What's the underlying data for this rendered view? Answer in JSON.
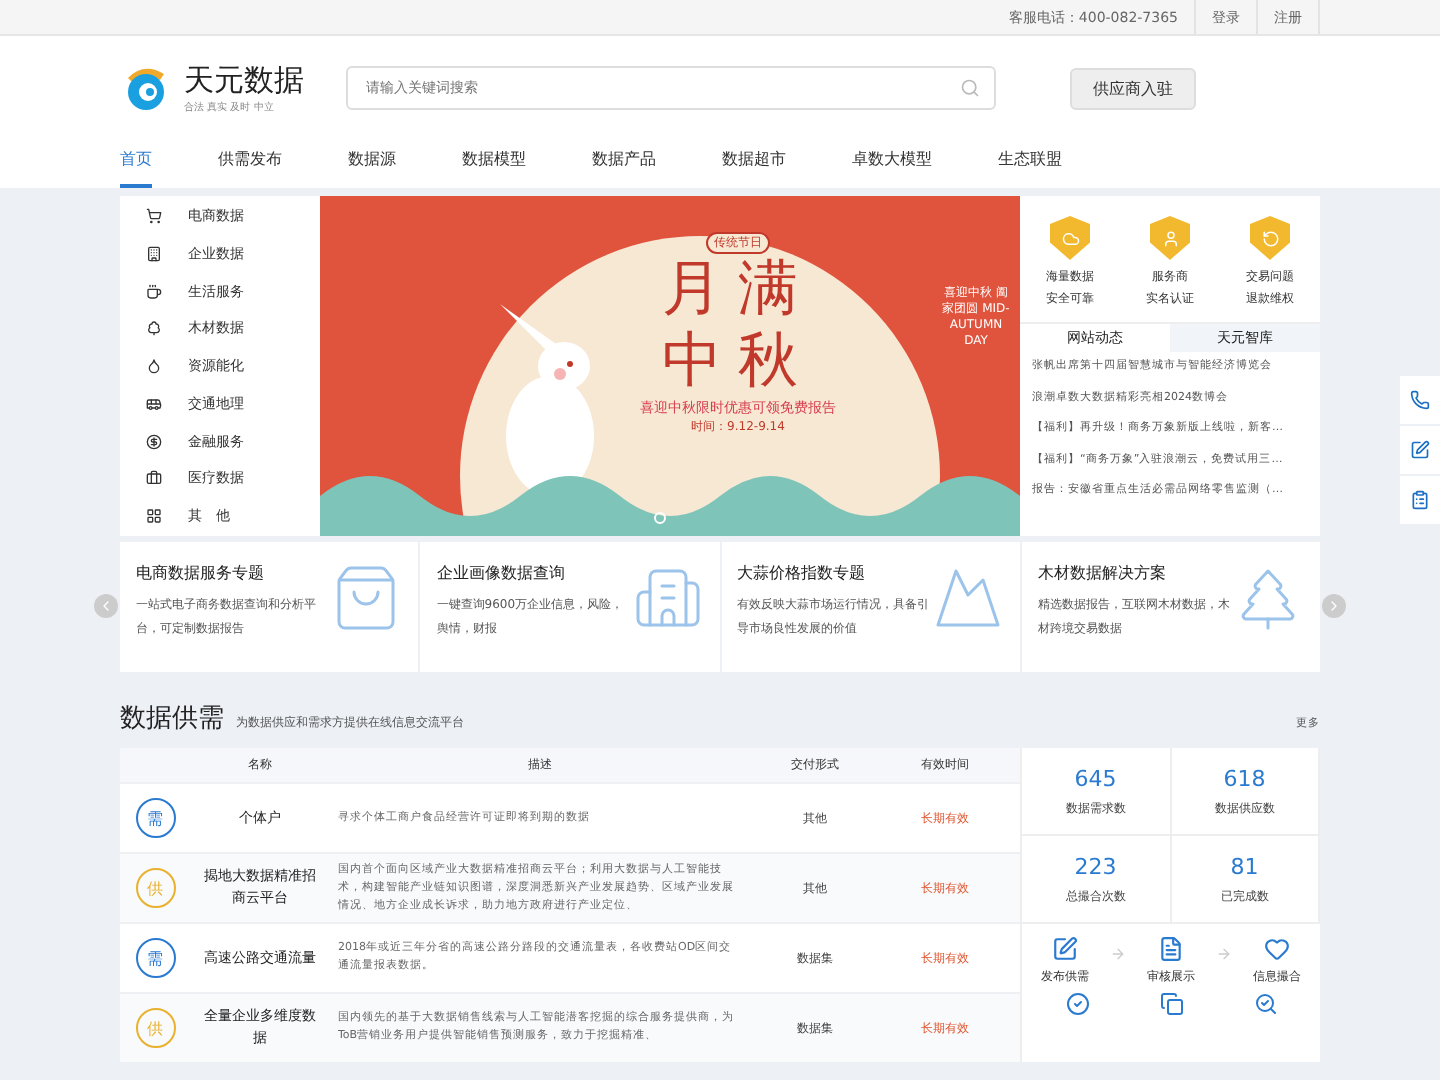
{
  "top_bar": {
    "hotline": "客服电话：400-082-7365",
    "links": [
      "登录",
      "注册"
    ]
  },
  "header": {
    "logo_name": "天元数据",
    "logo_slogan": "合法 真实 及时 中立",
    "search": {
      "placeholder": "请输入关键词搜索"
    },
    "join_button": "供应商入驻"
  },
  "nav": [
    {
      "label": "首页",
      "selected": true
    },
    {
      "label": "供需发布",
      "selected": false
    },
    {
      "label": "数据源",
      "selected": false
    },
    {
      "label": "数据模型",
      "selected": false
    },
    {
      "label": "数据产品",
      "selected": false
    },
    {
      "label": "数据超市",
      "selected": false
    },
    {
      "label": "卓数大模型",
      "selected": false
    },
    {
      "label": "生态联盟",
      "selected": false
    }
  ],
  "categories": [
    {
      "label": "电商数据",
      "kind": "cart"
    },
    {
      "label": "企业数据",
      "kind": "building"
    },
    {
      "label": "生活服务",
      "kind": "life"
    },
    {
      "label": "木材数据",
      "kind": "tree"
    },
    {
      "label": "资源能化",
      "kind": "resource"
    },
    {
      "label": "交通地理",
      "kind": "bus"
    },
    {
      "label": "金融服务",
      "kind": "finance"
    },
    {
      "label": "医疗数据",
      "kind": "medical"
    },
    {
      "label": "其　他",
      "kind": "other"
    }
  ],
  "banner": {
    "tag": "传统节日",
    "title_1": "月满",
    "title_2": "中秋",
    "subtitle": "喜迎中秋限时优惠可领免费报告",
    "date": "时间：9.12-9.14",
    "side_text": "喜迎中秋 阖家团圆 MID-AUTUMN DAY"
  },
  "guarantees": [
    {
      "line_1": "海量数据",
      "line_2": "安全可靠",
      "kind": "cloud"
    },
    {
      "line_1": "服务商",
      "line_2": "实名认证",
      "kind": "user"
    },
    {
      "line_1": "交易问题",
      "line_2": "退款维权",
      "kind": "refund"
    }
  ],
  "news_tabs": [
    {
      "label": "网站动态",
      "selected": true
    },
    {
      "label": "天元智库",
      "selected": false
    }
  ],
  "news": [
    "张帆出席第十四届智慧城市与智能经济博览会",
    "浪潮卓数大数据精彩亮相2024数博会",
    "【福利】再升级！商务万象新版上线啦，新客…",
    "【福利】“商务万象”入驻浪潮云，免费试用三…",
    "报告：安徽省重点生活必需品网络零售监测（…"
  ],
  "features": [
    {
      "title": "电商数据服务专题",
      "text": "一站式电子商务数据查询和分析平台，可定制数据报告",
      "kind": "bag"
    },
    {
      "title": "企业画像数据查询",
      "text": "一键查询9600万企业信息，风险，舆情，财报",
      "kind": "office"
    },
    {
      "title": "大蒜价格指数专题",
      "text": "有效反映大蒜市场运行情况，具备引导市场良性发展的价值",
      "kind": "mountain"
    },
    {
      "title": "木材数据解决方案",
      "text": "精选数据报告，互联网木材数据，木材跨境交易数据",
      "kind": "tree"
    }
  ],
  "section": {
    "title": "数据供需",
    "subtitle": "为数据供应和需求方提供在线信息交流平台",
    "more": "更多"
  },
  "table": {
    "columns": [
      "名称",
      "描述",
      "交付形式",
      "有效时间"
    ],
    "rows": [
      {
        "badge": "需",
        "kind": "demand",
        "name": "个体户",
        "description": "寻求个体工商户食品经营许可证即将到期的数据",
        "delivery": "其他",
        "validity": "长期有效"
      },
      {
        "badge": "供",
        "kind": "supply",
        "name": "揭地大数据精准招商云平台",
        "description": "国内首个面向区域产业大数据精准招商云平台；利用大数据与人工智能技术，构建智能产业链知识图谱，深度洞悉新兴产业发展趋势、区域产业发展情况、地方企业成长诉求，助力地方政府进行产业定位、",
        "delivery": "其他",
        "validity": "长期有效"
      },
      {
        "badge": "需",
        "kind": "demand",
        "name": "高速公路交通流量",
        "description": "2018年或近三年分省的高速公路分路段的交通流量表，各收费站OD区间交通流量报表数据。",
        "delivery": "数据集",
        "validity": "长期有效"
      },
      {
        "badge": "供",
        "kind": "supply",
        "name": "全量企业多维度数据",
        "description": "国内领先的基于大数据销售线索与人工智能潜客挖掘的综合服务提供商，为ToB营销业务用户提供智能销售预测服务，致力于挖掘精准、",
        "delivery": "数据集",
        "validity": "长期有效"
      }
    ]
  },
  "stats": [
    {
      "value": "645",
      "label": "数据需求数"
    },
    {
      "value": "618",
      "label": "数据供应数"
    },
    {
      "value": "223",
      "label": "总撮合次数"
    },
    {
      "value": "81",
      "label": "已完成数"
    }
  ],
  "flow_steps": [
    {
      "label": "发布供需",
      "kind": "edit"
    },
    {
      "label": "审核展示",
      "kind": "doc"
    },
    {
      "label": "信息撮合",
      "kind": "heart"
    }
  ],
  "float_tools": [
    {
      "kind": "phone"
    },
    {
      "kind": "edit"
    },
    {
      "kind": "clipboard"
    }
  ]
}
